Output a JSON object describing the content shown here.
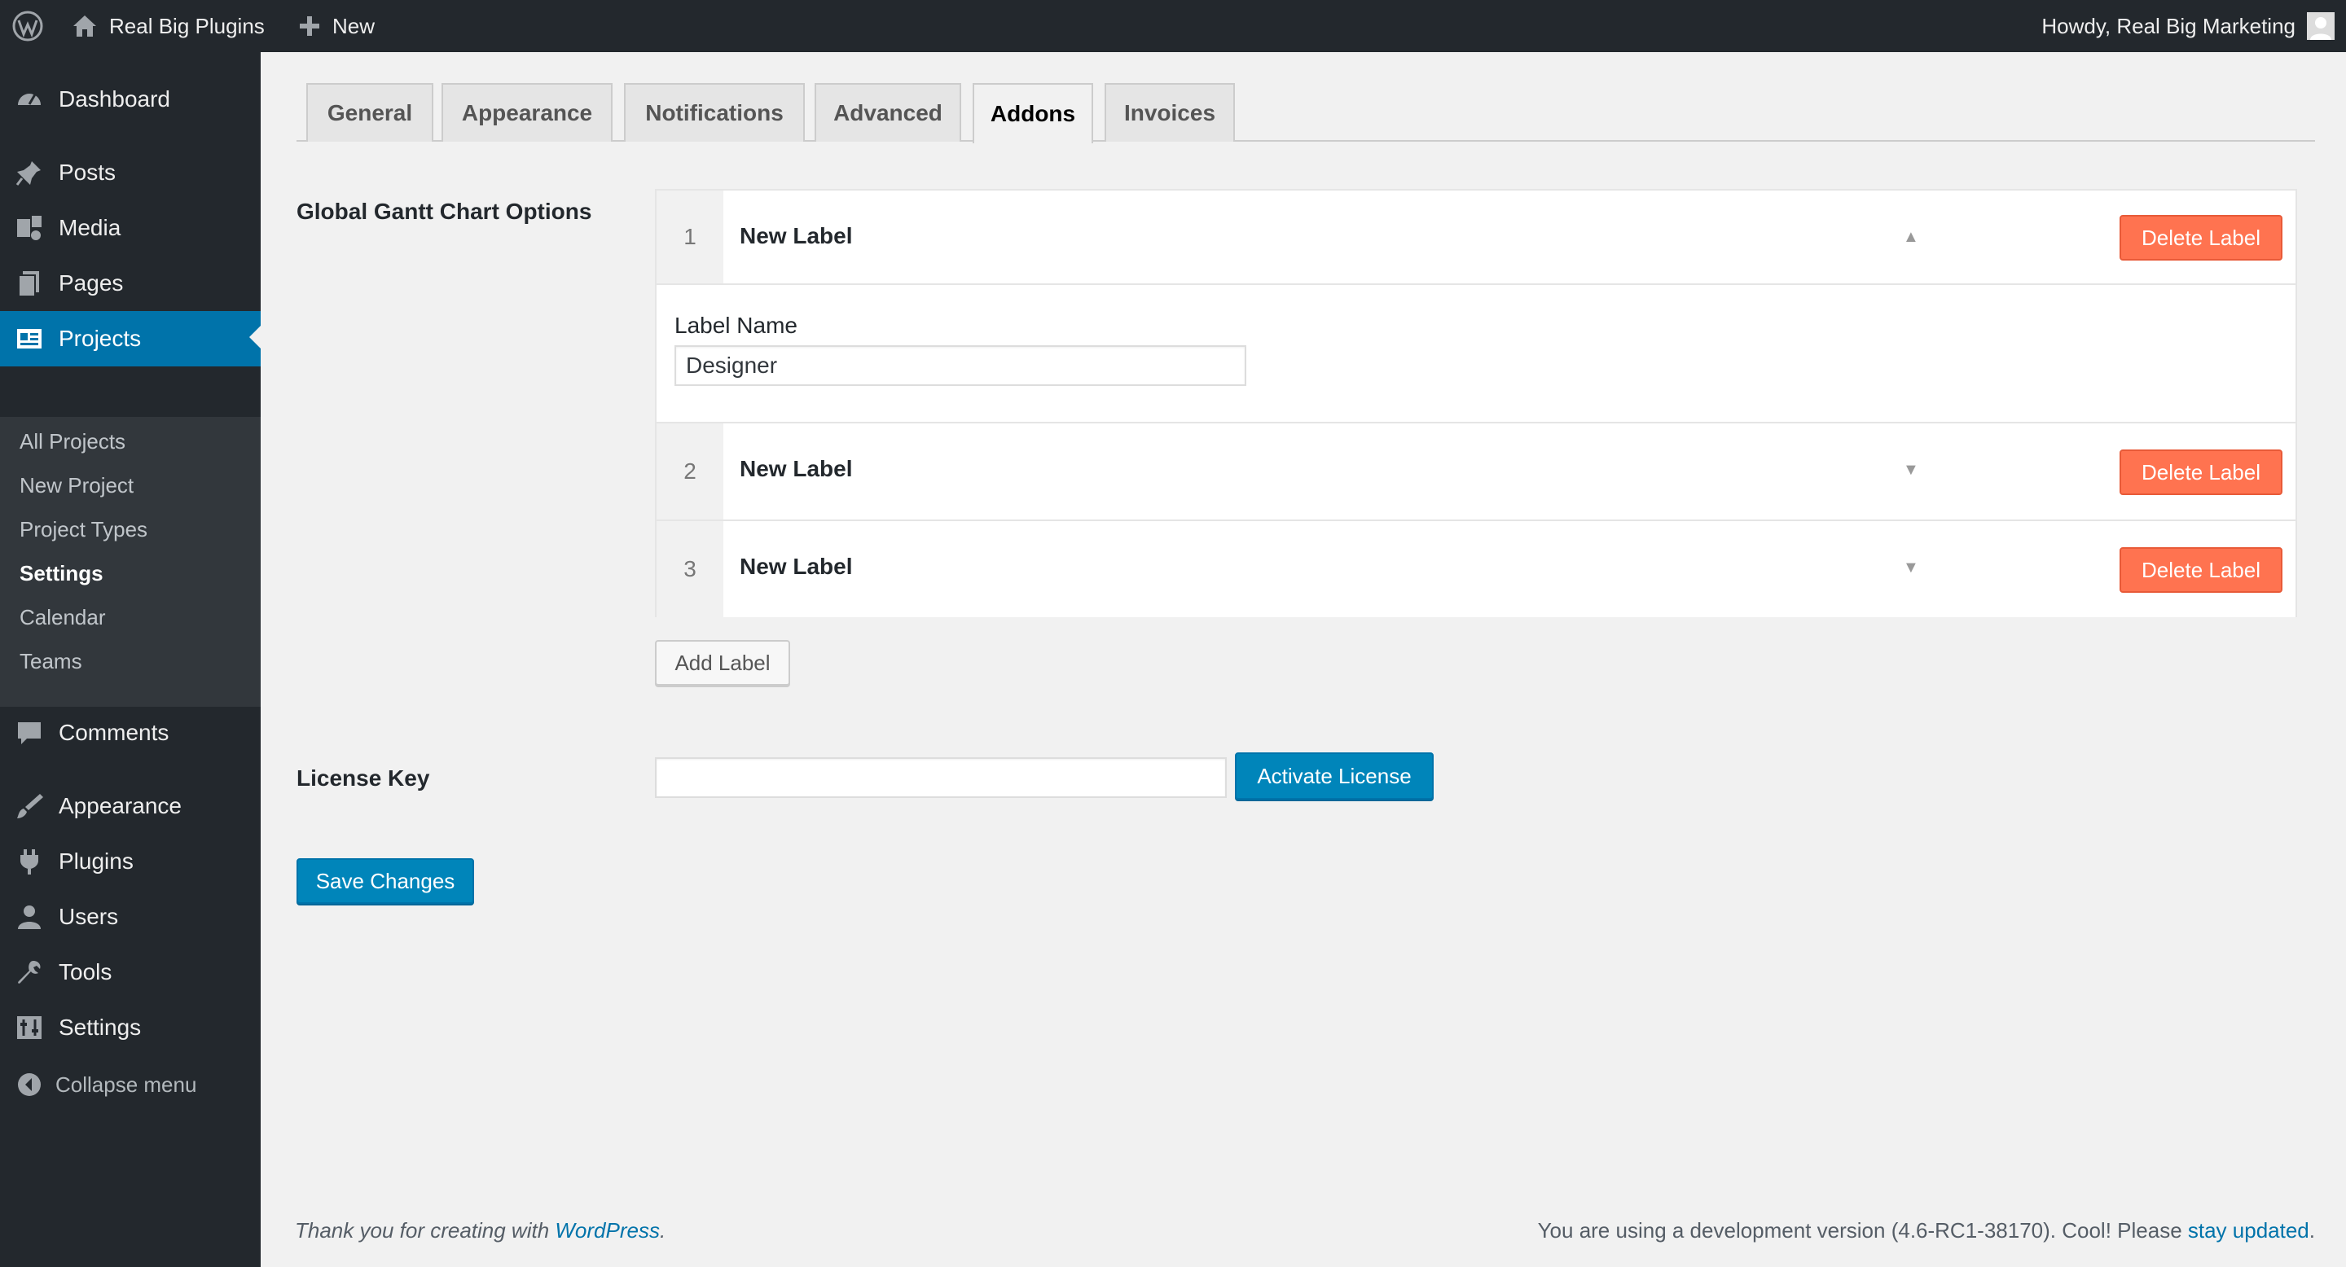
{
  "admin_bar": {
    "site_name": "Real Big Plugins",
    "new_label": "New",
    "howdy": "Howdy, Real Big Marketing"
  },
  "sidebar": {
    "items": [
      {
        "label": "Dashboard",
        "icon": "dashboard-icon"
      },
      {
        "label": "Posts",
        "icon": "pin-icon"
      },
      {
        "label": "Media",
        "icon": "media-icon"
      },
      {
        "label": "Pages",
        "icon": "pages-icon"
      },
      {
        "label": "Projects",
        "icon": "projects-icon",
        "current": true
      },
      {
        "label": "Comments",
        "icon": "comment-icon"
      },
      {
        "label": "Appearance",
        "icon": "brush-icon"
      },
      {
        "label": "Plugins",
        "icon": "plugin-icon"
      },
      {
        "label": "Users",
        "icon": "user-icon"
      },
      {
        "label": "Tools",
        "icon": "wrench-icon"
      },
      {
        "label": "Settings",
        "icon": "settings-icon"
      }
    ],
    "submenu": [
      {
        "label": "All Projects"
      },
      {
        "label": "New Project"
      },
      {
        "label": "Project Types"
      },
      {
        "label": "Settings",
        "current": true
      },
      {
        "label": "Calendar"
      },
      {
        "label": "Teams"
      }
    ],
    "collapse_label": "Collapse menu"
  },
  "tabs": [
    {
      "label": "General"
    },
    {
      "label": "Appearance"
    },
    {
      "label": "Notifications"
    },
    {
      "label": "Advanced"
    },
    {
      "label": "Addons",
      "active": true
    },
    {
      "label": "Invoices"
    }
  ],
  "gantt": {
    "section_label": "Global Gantt Chart Options",
    "labels": [
      {
        "number": "1",
        "title": "New Label",
        "expanded": true,
        "delete_label": "Delete Label"
      },
      {
        "number": "2",
        "title": "New Label",
        "expanded": false,
        "delete_label": "Delete Label"
      },
      {
        "number": "3",
        "title": "New Label",
        "expanded": false,
        "delete_label": "Delete Label"
      }
    ],
    "field_label": "Label Name",
    "field_value": "Designer",
    "add_label": "Add Label"
  },
  "license": {
    "label": "License Key",
    "value": "",
    "activate_label": "Activate License"
  },
  "save_label": "Save Changes",
  "footer": {
    "thanks_prefix": "Thank you for creating with ",
    "thanks_link": "WordPress",
    "thanks_suffix": ".",
    "version_text": "You are using a development version (4.6-RC1-38170). Cool! Please ",
    "version_link": "stay updated",
    "version_suffix": "."
  },
  "colors": {
    "admin_dark": "#23282d",
    "accent_blue": "#0073aa",
    "delete_orange": "#ff7350"
  }
}
